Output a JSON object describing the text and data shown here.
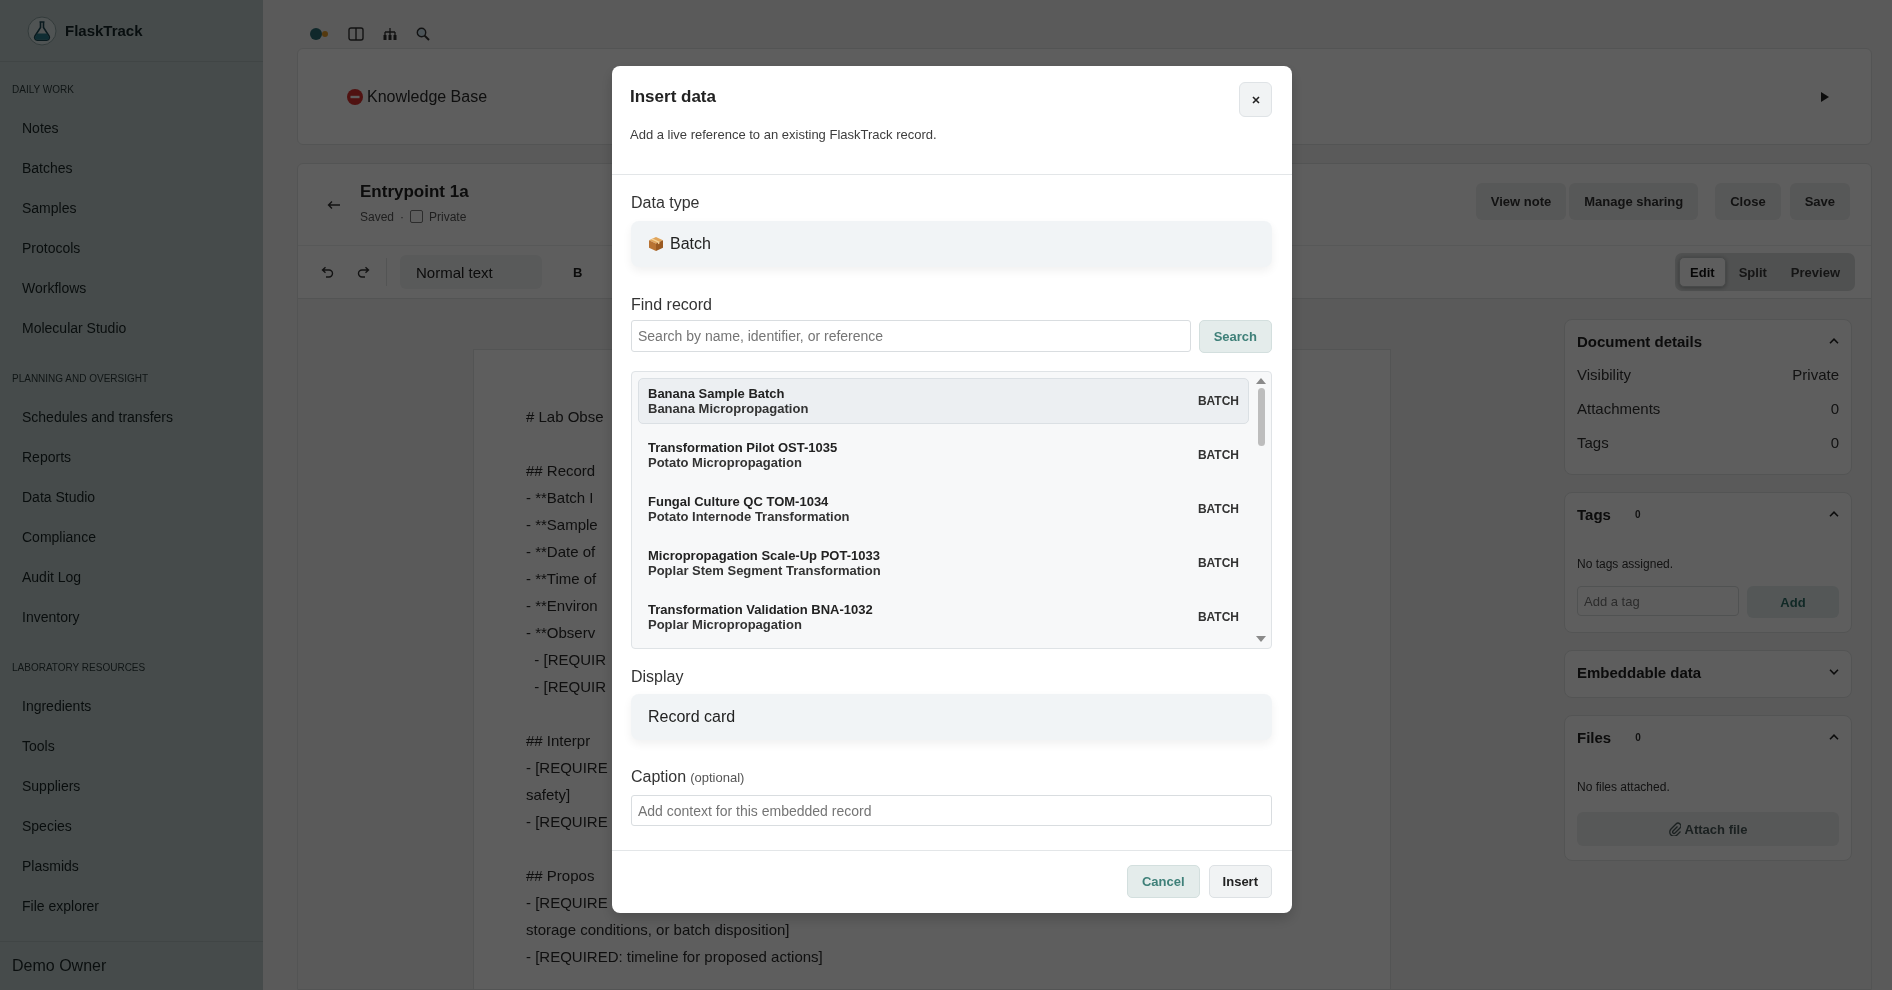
{
  "sidebar": {
    "brand": "FlaskTrack",
    "sections": [
      {
        "heading": "DAILY WORK",
        "items": [
          "Notes",
          "Batches",
          "Samples",
          "Protocols",
          "Workflows",
          "Molecular Studio"
        ]
      },
      {
        "heading": "PLANNING AND OVERSIGHT",
        "items": [
          "Schedules and transfers",
          "Reports",
          "Data Studio",
          "Compliance",
          "Audit Log",
          "Inventory"
        ]
      },
      {
        "heading": "LABORATORY RESOURCES",
        "items": [
          "Ingredients",
          "Tools",
          "Suppliers",
          "Species",
          "Plasmids",
          "File explorer"
        ]
      }
    ],
    "user": "Demo Owner"
  },
  "page_header": {
    "title": "Knowledge Base"
  },
  "note": {
    "title": "Entrypoint 1a",
    "status": "Saved",
    "separator": "·",
    "private": {
      "label": "Private",
      "checked": false
    },
    "action_groups": [
      [
        "View note",
        "Manage sharing"
      ],
      [
        "Close",
        "Save"
      ]
    ]
  },
  "toolbar": {
    "block_style": "Normal text",
    "bold": "B",
    "view_modes": [
      {
        "label": "Edit",
        "selected": true
      },
      {
        "label": "Split",
        "selected": false
      },
      {
        "label": "Preview",
        "selected": false
      }
    ]
  },
  "editor": {
    "blocks": [
      [
        "# Lab Obse"
      ],
      [
        "## Record",
        "- **Batch I",
        "- **Sample",
        "- **Date of",
        "- **Time of",
        "- **Environ",
        "- **Observ",
        "  - [REQUIR",
        "  - [REQUIR"
      ],
      [
        "## Interpr",
        "- [REQUIRE",
        "safety]",
        "- [REQUIRE"
      ],
      [
        "## Propos",
        "- [REQUIRE",
        "storage conditions, or batch disposition]",
        "- [REQUIRED: timeline for proposed actions]"
      ]
    ]
  },
  "side_panel": {
    "cards": [
      {
        "title": "Document details",
        "expanded": true,
        "rows": [
          {
            "label": "Visibility",
            "value": "Private"
          },
          {
            "label": "Attachments",
            "value": "0"
          },
          {
            "label": "Tags",
            "value": "0"
          }
        ]
      },
      {
        "title": "Tags",
        "count": "0",
        "expanded": true,
        "empty_text": "No tags assigned.",
        "input": {
          "placeholder": "Add a tag",
          "button": "Add"
        }
      },
      {
        "title": "Embeddable data",
        "expanded": false
      },
      {
        "title": "Files",
        "count": "0",
        "expanded": true,
        "empty_text": "No files attached.",
        "button": "Attach file"
      }
    ]
  },
  "modal": {
    "title": "Insert data",
    "subtitle": "Add a live reference to an existing FlaskTrack record.",
    "data_type": {
      "label": "Data type",
      "value": "Batch"
    },
    "find": {
      "label": "Find record",
      "placeholder": "Search by name, identifier, or reference",
      "button": "Search"
    },
    "results": [
      {
        "name": "Banana Sample Batch",
        "detail": "Banana Micropropagation",
        "type": "BATCH",
        "selected": true
      },
      {
        "name": "Transformation Pilot OST-1035",
        "detail": "Potato Micropropagation",
        "type": "BATCH",
        "selected": false
      },
      {
        "name": "Fungal Culture QC TOM-1034",
        "detail": "Potato Internode Transformation",
        "type": "BATCH",
        "selected": false
      },
      {
        "name": "Micropropagation Scale-Up POT-1033",
        "detail": "Poplar Stem Segment Transformation",
        "type": "BATCH",
        "selected": false
      },
      {
        "name": "Transformation Validation BNA-1032",
        "detail": "Poplar Micropropagation",
        "type": "BATCH",
        "selected": false
      }
    ],
    "display": {
      "label": "Display",
      "value": "Record card"
    },
    "caption": {
      "label": "Caption",
      "hint": "(optional)",
      "placeholder": "Add context for this embedded record"
    },
    "buttons": [
      {
        "label": "Cancel",
        "kind": "secondary"
      },
      {
        "label": "Insert",
        "kind": "primary"
      }
    ]
  }
}
